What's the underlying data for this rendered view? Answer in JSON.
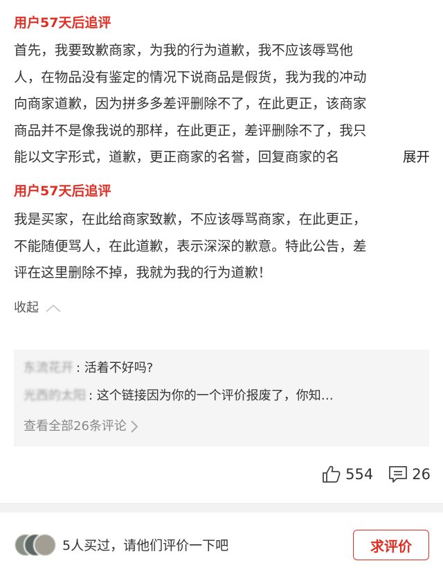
{
  "followups": [
    {
      "heading": "用户57天后追评",
      "lines": [
        "首先，我要致歉商家，为我的行为道歉，我不应该辱骂他",
        "人，在物品没有鉴定的情况下说商品是假货，我为我的冲动",
        "向商家道歉，因为拼多多差评删除不了，在此更正，该商家",
        "商品并不是像我说的那样，在此更正，差评删除不了，我只",
        "能以文字形式，道歉，更正商家的名誉，回复商家的名"
      ],
      "expand_label": "展开"
    },
    {
      "heading": "用户57天后追评",
      "lines": [
        "我是买家，在此给商家致歉，不应该辱骂商家，在此更正，",
        "不能随便骂人，在此道歉，表示深深的歉意。特此公告，差",
        "评在这里删除不掉，我就为我的行为道歉！"
      ]
    }
  ],
  "collapse_label": "收起",
  "comments": {
    "items": [
      {
        "name": "东流花开",
        "text": "活着不好吗?"
      },
      {
        "name": "光西的太阳",
        "text": "这个链接因为你的一个评价报废了，你知…"
      }
    ],
    "view_all": "查看全部26条评论"
  },
  "stats": {
    "likes": "554",
    "comments": "26"
  },
  "bottom": {
    "bought_text": "5人买过，请他们评价一下吧",
    "ask_button": "求评价"
  },
  "colors": {
    "accent": "#e02e24",
    "box_bg": "#f5f5f5",
    "muted": "#888888"
  }
}
